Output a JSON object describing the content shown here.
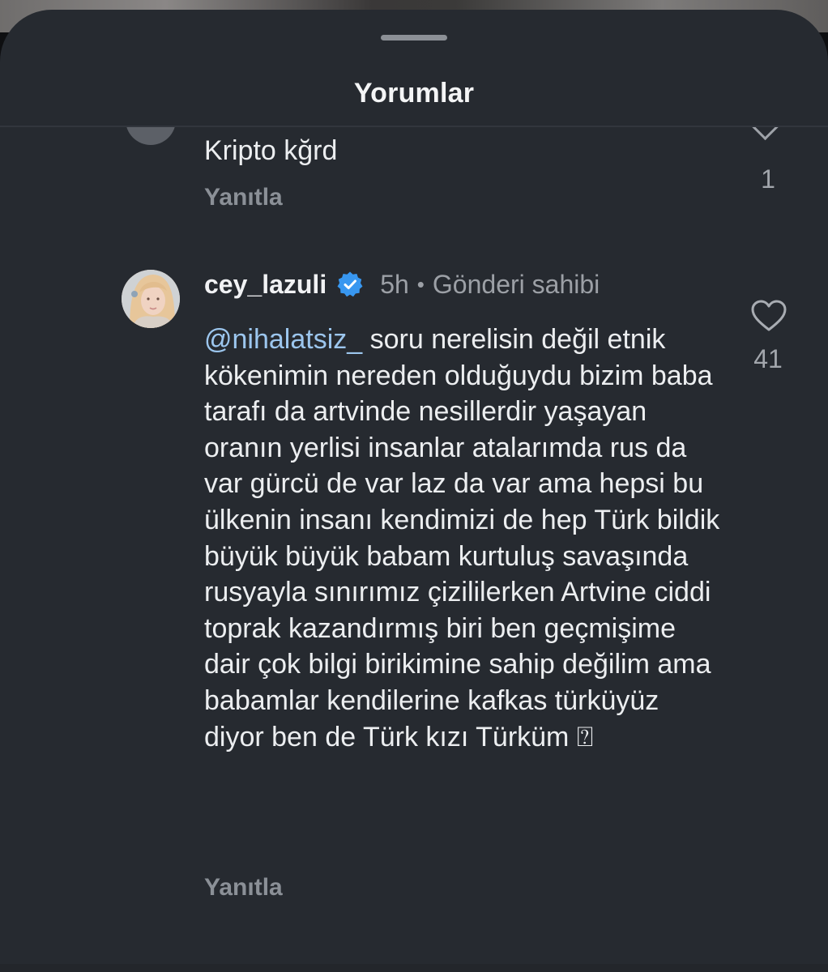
{
  "sheet": {
    "title": "Yorumlar"
  },
  "previous_comment": {
    "text": "Kripto kğrd",
    "reply_label": "Yanıtla",
    "count": "1"
  },
  "comment": {
    "username": "cey_lazuli",
    "verified": true,
    "time": "5h",
    "separator": "•",
    "author_badge": "Gönderi sahibi",
    "mention": "@nihalatsiz_",
    "text": " soru nerelisin değil etnik kökenimin nereden olduğuydu bizim baba tarafı da artvinde nesillerdir yaşayan oranın yerlisi insanlar atalarımda rus da var gürcü de var laz da var ama hepsi bu ülkenin insanı kendimizi de hep Türk bildik büyük büyük babam kurtuluş savaşında rusyayla sınırımız çizililerken Artvine ciddi toprak kazandırmış biri ben geçmişime dair çok bilgi birikimine sahip değilim ama babamlar kendilerine kafkas türküyüz diyor ben de Türk kızı Türküm ",
    "trailing_glyph": "⍰",
    "reply_label": "Yanıtla",
    "like_count": "41"
  },
  "icons": {
    "like": "heart-outline-icon",
    "verified": "verified-badge-icon",
    "expand": "chevron-down-icon"
  },
  "colors": {
    "sheet_background": "#262a30",
    "mention": "#9cc6ee",
    "verified_blue": "#3897f0",
    "muted_text": "#9ca0a6"
  }
}
